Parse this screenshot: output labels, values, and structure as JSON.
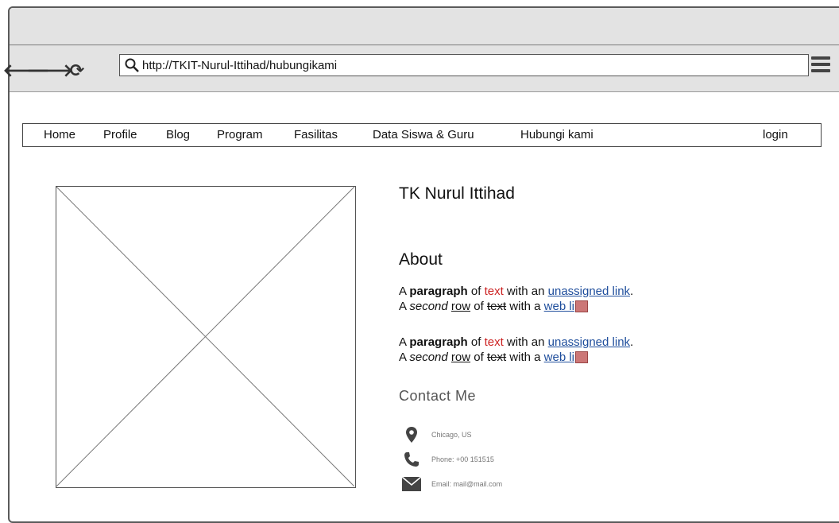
{
  "browser": {
    "url": "http://TKIT-Nurul-Ittihad/hubungikami",
    "back_icon": "arrow-left-icon",
    "forward_icon": "arrow-right-icon",
    "reload_icon": "reload-icon",
    "search_icon": "search-icon",
    "menu_icon": "hamburger-menu-icon"
  },
  "nav": {
    "items": [
      "Home",
      "Profile",
      "Blog",
      "Program",
      "Fasilitas",
      "Data Siswa & Guru",
      "Hubungi kami"
    ],
    "login": "login"
  },
  "main": {
    "title": "TK Nurul Ittihad",
    "about_heading": "About",
    "paragraphs": [
      {
        "line1": {
          "a": "A ",
          "b": "paragraph",
          "c": " of ",
          "d": "text",
          "e": " with an ",
          "link": "unassigned link",
          "end": "."
        },
        "line2": {
          "a": "A ",
          "b": "second",
          "c": " ",
          "d": "row",
          "e": " of ",
          "f": "text",
          "g": " with a ",
          "link": "web li"
        }
      },
      {
        "line1": {
          "a": "A ",
          "b": "paragraph",
          "c": " of ",
          "d": "text",
          "e": " with an ",
          "link": "unassigned link",
          "end": "."
        },
        "line2": {
          "a": "A ",
          "b": "second",
          "c": " ",
          "d": "row",
          "e": " of ",
          "f": "text",
          "g": " with a ",
          "link": "web li"
        }
      }
    ],
    "contact": {
      "heading": "Contact Me",
      "location": "Chicago, US",
      "phone": "Phone: +00 151515",
      "email": "Email: mail@mail.com"
    }
  },
  "colors": {
    "red_text": "#cc2222",
    "link": "#1f4e9c"
  }
}
